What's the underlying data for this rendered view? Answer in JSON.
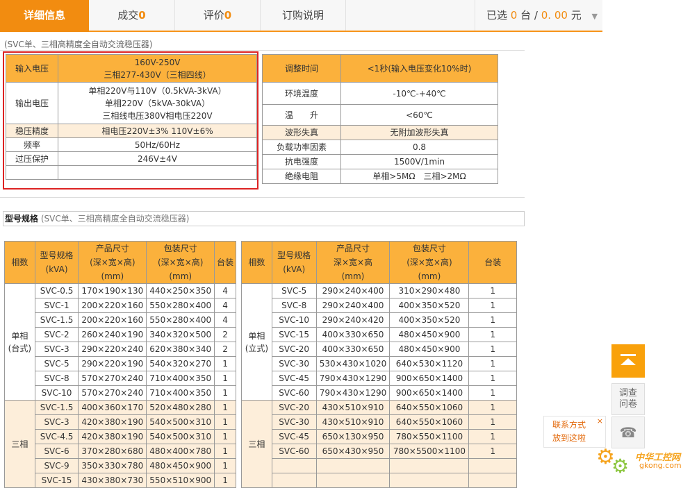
{
  "tabs": {
    "details": "详细信息",
    "deals_label": "成交",
    "deals_count": "0",
    "reviews_label": "评价",
    "reviews_count": "0",
    "order_info": "订购说明"
  },
  "selected": {
    "prefix": "已选",
    "units": "0",
    "unit_label": "台",
    "sep": "/",
    "amount": "0. 00",
    "currency": "元"
  },
  "subtitle": "(SVC单、三相高精度全自动交流稳压器)",
  "spec_left": [
    {
      "label": "输入电压",
      "lines": [
        "160V-250V",
        "三相277-430V（三相四线）"
      ],
      "style": "org"
    },
    {
      "label": "输出电压",
      "lines": [
        "单相220V与110V（0.5kVA-3kVA）",
        "单相220V（5kVA-30kVA）",
        "三相线电压380V相电压220V"
      ],
      "style": "white"
    },
    {
      "label": "稳压精度",
      "lines": [
        "相电压220V±3% 110V±6%"
      ],
      "style": "cream"
    },
    {
      "label": "频率",
      "lines": [
        "50Hz/60Hz"
      ],
      "style": "white"
    },
    {
      "label": "过压保护",
      "lines": [
        "246V±4V"
      ],
      "style": "white"
    },
    {
      "label": "",
      "lines": [
        ""
      ],
      "style": "white"
    }
  ],
  "spec_right": [
    {
      "label": "调整时间",
      "value": "<1秒(输入电压变化10%时)",
      "style": "org"
    },
    {
      "label": "环境温度",
      "value": "-10℃-+40℃",
      "style": "white"
    },
    {
      "label": "温　　升",
      "value": "<60℃",
      "style": "white"
    },
    {
      "label": "波形失真",
      "value": "无附加波形失真",
      "style": "cream"
    },
    {
      "label": "负载功率因素",
      "value": "0.8",
      "style": "white"
    },
    {
      "label": "抗电强度",
      "value": "1500V/1min",
      "style": "white"
    },
    {
      "label": "绝缘电阻",
      "value": "单相>5MΩ　三相>2MΩ",
      "style": "white"
    }
  ],
  "model_section": {
    "title": "型号规格",
    "subtitle": "(SVC单、三相高精度全自动交流稳压器)"
  },
  "model_left": {
    "headers": [
      "相数",
      "型号规格\n(kVA)",
      "产品尺寸\n(深×宽×高)\n(mm)",
      "包装尺寸\n(深×宽×高)\n(mm)",
      "台装"
    ],
    "groups": [
      {
        "name": "单相\n(台式)",
        "style": "white",
        "rows": [
          [
            "SVC-0.5",
            "170×190×130",
            "440×250×350",
            "4"
          ],
          [
            "SVC-1",
            "200×220×160",
            "550×280×400",
            "4"
          ],
          [
            "SVC-1.5",
            "200×220×160",
            "550×280×400",
            "4"
          ],
          [
            "SVC-2",
            "260×240×190",
            "340×320×500",
            "2"
          ],
          [
            "SVC-3",
            "290×220×240",
            "620×380×340",
            "2"
          ],
          [
            "SVC-5",
            "290×220×190",
            "540×320×270",
            "1"
          ],
          [
            "SVC-8",
            "570×270×240",
            "710×400×350",
            "1"
          ],
          [
            "SVC-10",
            "570×270×240",
            "710×400×350",
            "1"
          ]
        ]
      },
      {
        "name": "三相",
        "style": "cream",
        "rows": [
          [
            "SVC-1.5",
            "400×360×170",
            "520×480×280",
            "1"
          ],
          [
            "SVC-3",
            "420×380×190",
            "540×500×310",
            "1"
          ],
          [
            "SVC-4.5",
            "420×380×190",
            "540×500×310",
            "1"
          ],
          [
            "SVC-6",
            "370×280×680",
            "480×400×780",
            "1"
          ],
          [
            "SVC-9",
            "350×330×780",
            "480×450×900",
            "1"
          ],
          [
            "SVC-15",
            "430×380×730",
            "550×510×900",
            "1"
          ]
        ]
      }
    ]
  },
  "model_right": {
    "headers": [
      "相数",
      "型号规格\n(kVA)",
      "产品尺寸\n深×宽×高\n(mm)",
      "包装尺寸\n(深×宽×高)\n(mm)",
      "台装"
    ],
    "groups": [
      {
        "name": "单相\n(立式)",
        "style": "white",
        "rows": [
          [
            "SVC-5",
            "290×240×400",
            "310×290×480",
            "1"
          ],
          [
            "SVC-8",
            "290×240×400",
            "400×350×520",
            "1"
          ],
          [
            "SVC-10",
            "290×240×420",
            "400×350×520",
            "1"
          ],
          [
            "SVC-15",
            "400×330×650",
            "480×450×900",
            "1"
          ],
          [
            "SVC-20",
            "400×330×650",
            "480×450×900",
            "1"
          ],
          [
            "SVC-30",
            "530×430×1020",
            "640×530×1120",
            "1"
          ],
          [
            "SVC-45",
            "790×430×1290",
            "900×650×1400",
            "1"
          ],
          [
            "SVC-60",
            "790×430×1290",
            "900×650×1400",
            "1"
          ]
        ]
      },
      {
        "name": "三相",
        "style": "cream",
        "rows": [
          [
            "SVC-20",
            "430×510×910",
            "640×550×1060",
            "1"
          ],
          [
            "SVC-30",
            "430×510×910",
            "640×550×1060",
            "1"
          ],
          [
            "SVC-45",
            "650×130×950",
            "780×550×1100",
            "1"
          ],
          [
            "SVC-60",
            "650×430×950",
            "780×5500×1100",
            "1"
          ],
          [
            "",
            "",
            "",
            ""
          ],
          [
            "",
            "",
            "",
            ""
          ]
        ]
      }
    ]
  },
  "side": {
    "survey": "调查\n问卷",
    "contact_line1": "联系方式",
    "contact_line2": "放到这啦",
    "close": "×",
    "phone_icon": "☎"
  },
  "watermark": {
    "brand": "中华工控网",
    "domain": "gkong.com"
  }
}
